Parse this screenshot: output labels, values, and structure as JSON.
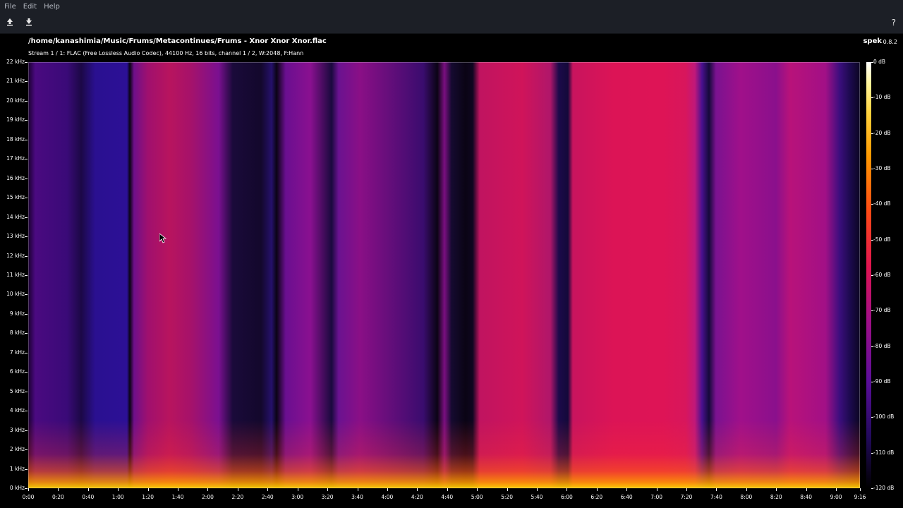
{
  "menu": {
    "items": [
      {
        "label": "File"
      },
      {
        "label": "Edit"
      },
      {
        "label": "Help"
      }
    ]
  },
  "toolbar": {
    "open_icon": "upload-arrow-icon",
    "save_icon": "download-arrow-icon",
    "help_label": "?"
  },
  "header": {
    "file_path": "/home/kanashimia/Music/Frums/Metacontinues/Frums - Xnor Xnor Xnor.flac",
    "stream_info": "Stream 1 / 1: FLAC (Free Lossless Audio Codec), 44100 Hz, 16 bits, channel 1 / 2, W:2048, F:Hann",
    "app_name": "spek",
    "app_version": "0.8.2"
  },
  "freq_axis": {
    "labels": [
      "22 kHz",
      "21 kHz",
      "20 kHz",
      "19 kHz",
      "18 kHz",
      "17 kHz",
      "16 kHz",
      "15 kHz",
      "14 kHz",
      "13 kHz",
      "12 kHz",
      "11 kHz",
      "10 kHz",
      "9 kHz",
      "8 kHz",
      "7 kHz",
      "6 kHz",
      "5 kHz",
      "4 kHz",
      "3 kHz",
      "2 kHz",
      "1 kHz",
      "0 kHz"
    ],
    "max_khz": 22
  },
  "time_axis": {
    "labels": [
      "0:00",
      "0:20",
      "0:40",
      "1:00",
      "1:20",
      "1:40",
      "2:00",
      "2:20",
      "2:40",
      "3:00",
      "3:20",
      "3:40",
      "4:00",
      "4:20",
      "4:40",
      "5:00",
      "5:20",
      "5:40",
      "6:00",
      "6:20",
      "6:40",
      "7:00",
      "7:20",
      "7:40",
      "8:00",
      "8:20",
      "8:40",
      "9:00",
      "9:16"
    ],
    "seconds": [
      0,
      20,
      40,
      60,
      80,
      100,
      120,
      140,
      160,
      180,
      200,
      220,
      240,
      260,
      280,
      300,
      320,
      340,
      360,
      380,
      400,
      420,
      440,
      460,
      480,
      500,
      520,
      540,
      556
    ],
    "duration_seconds": 556
  },
  "db_scale": {
    "labels": [
      "0 dB",
      "-10 dB",
      "-20 dB",
      "-30 dB",
      "-40 dB",
      "-50 dB",
      "-60 dB",
      "-70 dB",
      "-80 dB",
      "-90 dB",
      "-100 dB",
      "-110 dB",
      "-120 dB"
    ],
    "min_db": -120,
    "max_db": 0
  },
  "colors": {
    "bar_bg": "#1c1f26",
    "menu_text": "#b5b9c2"
  }
}
